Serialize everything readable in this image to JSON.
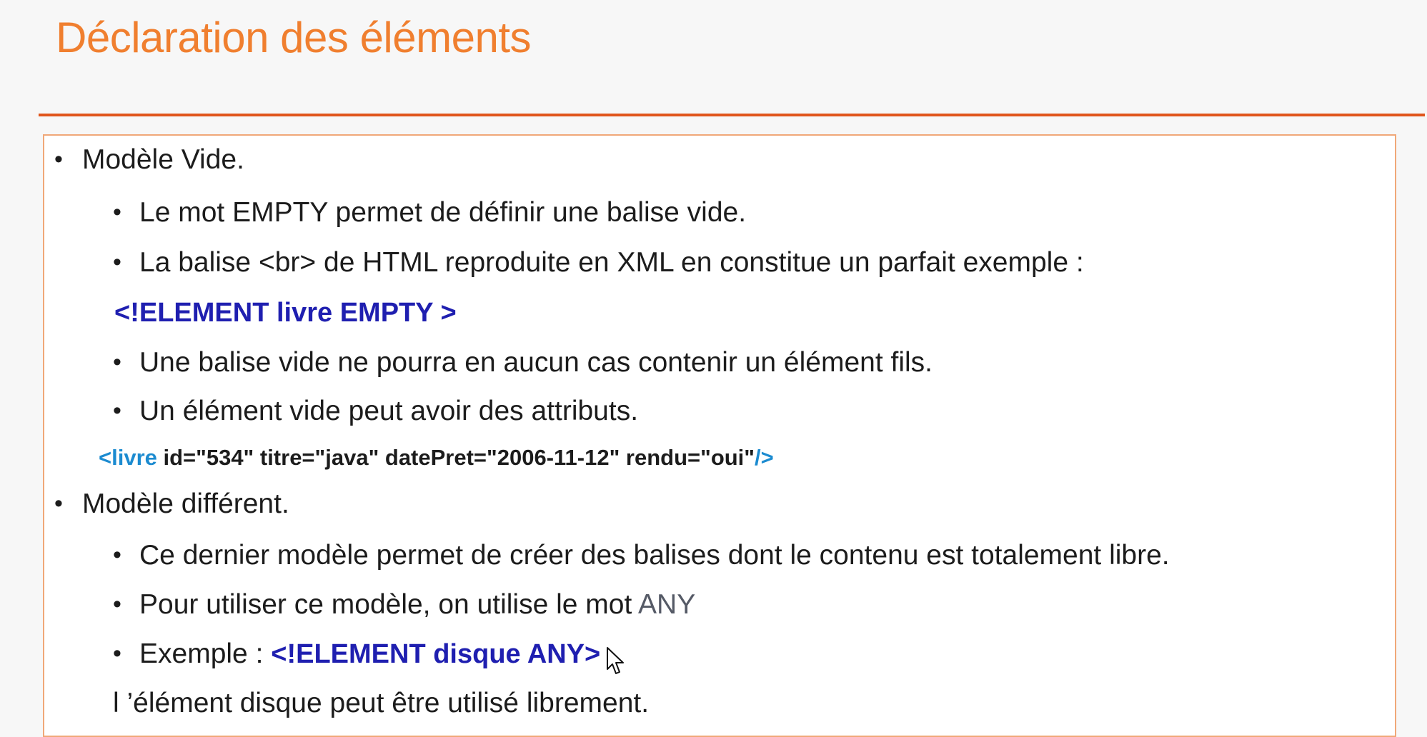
{
  "title": "Déclaration des éléments",
  "sections": {
    "vide": {
      "heading": "Modèle Vide.",
      "item1": "Le mot EMPTY permet de définir une balise vide.",
      "item2": "La balise <br> de HTML reproduite en XML en constitue un parfait exemple :",
      "code": "<!ELEMENT  livre  EMPTY >",
      "item3": "Une balise vide ne pourra en aucun cas contenir un élément fils.",
      "item4": "Un élément vide peut avoir des attributs.",
      "xml_open": "<livre",
      "xml_attrs": " id=\"534\" titre=\"java\" datePret=\"2006-11-12\" rendu=\"oui\"",
      "xml_close": "/>"
    },
    "different": {
      "heading": "Modèle différent.",
      "item1": "Ce dernier modèle permet de créer des balises  dont le contenu est totalement libre.",
      "item2": "Pour utiliser ce modèle, on utilise le mot ",
      "item2_keyword": "ANY",
      "item3_label": "Exemple : ",
      "item3_code": "<!ELEMENT disque  ANY>",
      "note": "l ’élément  disque peut être utilisé librement."
    }
  },
  "colors": {
    "title": "#f07f2f",
    "rule": "#e0551c",
    "code": "#1f1fb0",
    "xml_tag": "#1c8bd0"
  },
  "icons": {
    "bullet": "•",
    "cursor": "mouse-pointer-icon"
  }
}
